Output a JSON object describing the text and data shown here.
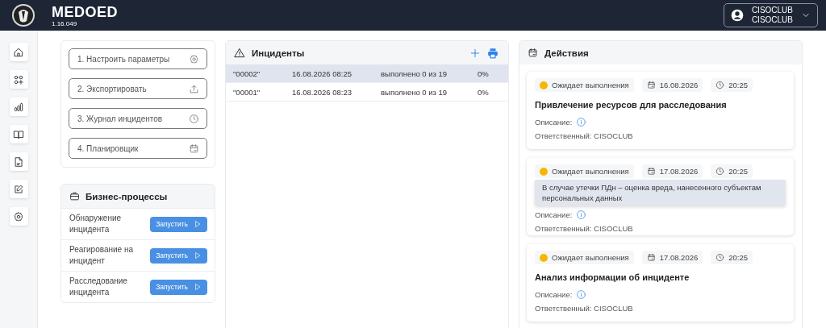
{
  "app": {
    "name": "MEDOED",
    "version": "1.16.049"
  },
  "user": {
    "line_1": "CISOCLUB",
    "line_2": "CISOCLUB"
  },
  "steps": [
    {
      "label": "1. Настроить параметры",
      "kind": "gear"
    },
    {
      "label": "2. Экспортировать",
      "kind": "upload"
    },
    {
      "label": "3. Журнал инцидентов",
      "kind": "clock"
    },
    {
      "label": "4. Планировщик",
      "kind": "calendar"
    }
  ],
  "business_processes": {
    "title": "Бизнес-процессы",
    "rows": [
      {
        "name": "Обнаружение инцидента",
        "button": "Запустить"
      },
      {
        "name": "Реагирование на инцидент",
        "button": "Запустить"
      },
      {
        "name": "Расследование инцидента",
        "button": "Запустить"
      }
    ]
  },
  "incidents": {
    "title": "Инциденты",
    "rows": [
      {
        "id": "\"00002\"",
        "created": "16.08.2026 08:25",
        "progress": "выполнено 0 из 19",
        "percent": "0%",
        "selected": true
      },
      {
        "id": "\"00001\"",
        "created": "16.08.2026 08:23",
        "progress": "выполнено 0 из 19",
        "percent": "0%",
        "selected": false
      }
    ]
  },
  "actions": {
    "title": "Действия",
    "cards": [
      {
        "status": "Ожидает выполнения",
        "date": "16.08.2026",
        "time": "20:25",
        "title": "Привлечение ресурсов для расследования",
        "description_label": "Описание:",
        "responsible": "Ответственный: CISOCLUB"
      },
      {
        "status": "Ожидает выполнения",
        "date": "17.08.2026",
        "time": "20:25",
        "tooltip": "В случае утечки ПДн – оценка вреда, нанесенного субъектам персональных данных",
        "description_label": "Описание:",
        "responsible": "Ответственный: CISOCLUB"
      },
      {
        "status": "Ожидает выполнения",
        "date": "17.08.2026",
        "time": "20:25",
        "title": "Анализ информации об инциденте",
        "description_label": "Описание:",
        "responsible": "Ответственный: CISOCLUB"
      }
    ]
  }
}
